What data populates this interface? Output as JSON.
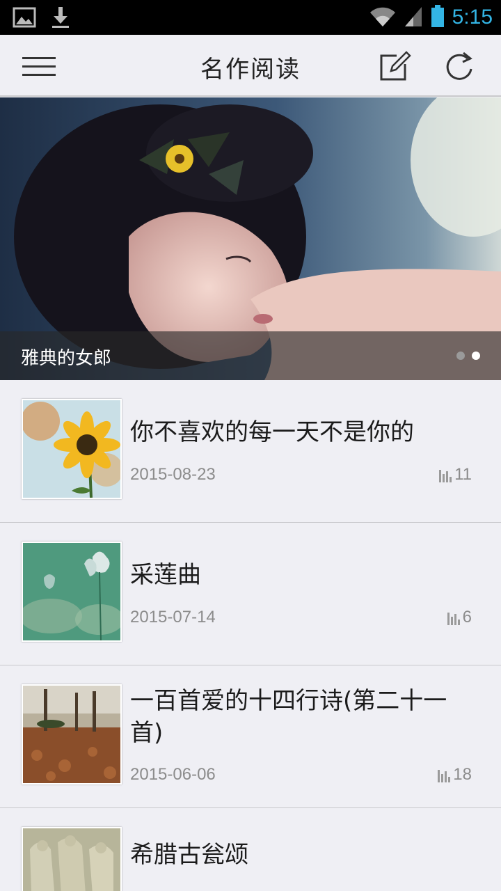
{
  "status_bar": {
    "time": "5:15",
    "left_icons": [
      "gallery-icon",
      "download-icon"
    ],
    "right_icons": [
      "wifi-icon",
      "signal-icon",
      "battery-icon"
    ],
    "accent_color": "#33b5e5"
  },
  "action_bar": {
    "title": "名作阅读",
    "icons": [
      "menu-icon",
      "edit-icon",
      "refresh-icon"
    ]
  },
  "banner": {
    "caption": "雅典的女郎",
    "pages": 2,
    "active_page": 2
  },
  "articles": [
    {
      "title": "你不喜欢的每一天不是你的",
      "date": "2015-08-23",
      "count": "11"
    },
    {
      "title": "采莲曲",
      "date": "2015-07-14",
      "count": "6"
    },
    {
      "title": "一百首爱的十四行诗(第二十一首)",
      "date": "2015-06-06",
      "count": "18"
    },
    {
      "title": "希腊古瓮颂",
      "date": "",
      "count": ""
    }
  ]
}
